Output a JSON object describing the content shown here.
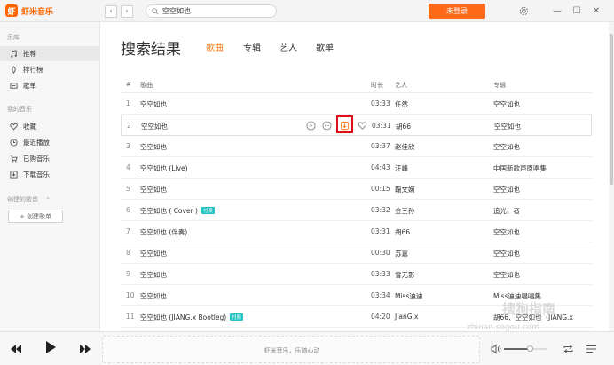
{
  "app": {
    "logo_glyph": "虾",
    "name": "虾米音乐"
  },
  "titlebar": {
    "back_glyph": "‹",
    "forward_glyph": "›",
    "search_value": "空空如也",
    "login_label": "未登录",
    "min_glyph": "—",
    "max_glyph": "☐",
    "close_glyph": "✕"
  },
  "sidebar": {
    "section_library": "乐库",
    "library_items": [
      {
        "label": "推荐",
        "icon": "music-note-icon",
        "active": true
      },
      {
        "label": "排行榜",
        "icon": "chart-icon",
        "active": false
      },
      {
        "label": "歌单",
        "icon": "playlist-icon",
        "active": false
      }
    ],
    "section_my": "我的音乐",
    "my_items": [
      {
        "label": "收藏",
        "icon": "heart-icon"
      },
      {
        "label": "最近播放",
        "icon": "clock-icon"
      },
      {
        "label": "已购音乐",
        "icon": "cart-icon"
      },
      {
        "label": "下载音乐",
        "icon": "download-icon"
      }
    ],
    "section_created": "创建的歌单",
    "collapse_glyph": "⌃",
    "create_label": "+ 创建歌单"
  },
  "main": {
    "page_title": "搜索结果",
    "tabs": [
      "歌曲",
      "专辑",
      "艺人",
      "歌单"
    ],
    "columns": {
      "num": "#",
      "title": "歌曲",
      "duration": "时长",
      "artist": "艺人",
      "album": "专辑"
    },
    "rows": [
      {
        "num": "1",
        "title": "空空如也",
        "tag": "",
        "duration": "03:33",
        "artist": "任然",
        "album": "空空如也"
      },
      {
        "num": "2",
        "title": "空空如也",
        "tag": "",
        "duration": "03:31",
        "artist": "胡66",
        "album": "空空如也"
      },
      {
        "num": "3",
        "title": "空空如也",
        "tag": "",
        "duration": "03:37",
        "artist": "赵佳欣",
        "album": "空空如也"
      },
      {
        "num": "4",
        "title": "空空如也 (Live)",
        "tag": "",
        "duration": "04:43",
        "artist": "汪峰",
        "album": "中国新歌声原唱集"
      },
      {
        "num": "5",
        "title": "空空如也",
        "tag": "",
        "duration": "00:15",
        "artist": "鞠文娴",
        "album": "空空如也"
      },
      {
        "num": "6",
        "title": "空空如也 ( Cover )",
        "tag": "付费",
        "duration": "03:32",
        "artist": "金三孙",
        "album": "追光、者"
      },
      {
        "num": "7",
        "title": "空空如也 (伴奏)",
        "tag": "",
        "duration": "03:31",
        "artist": "胡66",
        "album": "空空如也"
      },
      {
        "num": "8",
        "title": "空空如也",
        "tag": "",
        "duration": "00:30",
        "artist": "苏嘉",
        "album": "空空如也"
      },
      {
        "num": "9",
        "title": "空空如也",
        "tag": "",
        "duration": "03:33",
        "artist": "雪无影",
        "album": "空空如也"
      },
      {
        "num": "10",
        "title": "空空如也",
        "tag": "",
        "duration": "03:34",
        "artist": "Miss迪迪",
        "album": "Miss迪迪唱唱集"
      },
      {
        "num": "11",
        "title": "空空如也 (JIANG.x Bootleg)",
        "tag": "付费",
        "duration": "04:20",
        "artist": "JIanG.x",
        "album": "胡66、空空如也（JIANG.x"
      }
    ]
  },
  "player": {
    "now_playing": "虾米音乐，乐随心动"
  },
  "watermark": {
    "main": "搜狗指南",
    "sub": "zhinan.sogou.com"
  },
  "colors": {
    "accent": "#ff6a1a",
    "highlight_box": "#e0101a",
    "tag": "#23c3c3"
  }
}
